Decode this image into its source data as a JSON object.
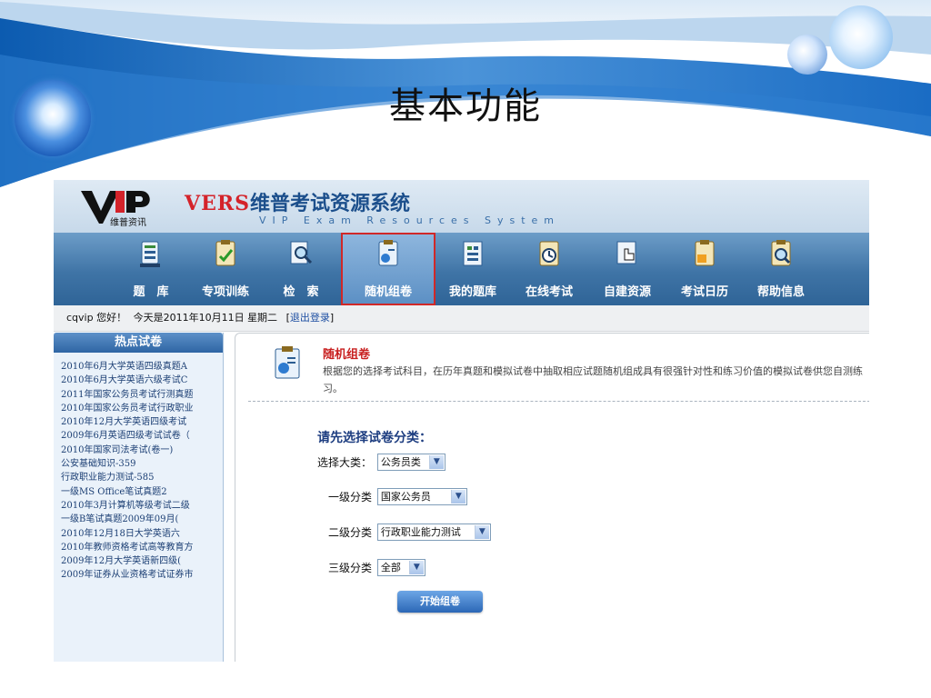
{
  "slide": {
    "title": "基本功能"
  },
  "app": {
    "logo_sub": "维普资讯",
    "title_en": "VERS",
    "title_cn": "维普考试资源系统",
    "subtitle": "VIP Exam Resources System"
  },
  "nav": {
    "items": [
      {
        "label": "题　库",
        "icon": "database-icon"
      },
      {
        "label": "专项训练",
        "icon": "clipboard-check-icon"
      },
      {
        "label": "检　索",
        "icon": "search-document-icon"
      },
      {
        "label": "随机组卷",
        "icon": "random-paper-icon",
        "active": true
      },
      {
        "label": "我的题库",
        "icon": "my-database-icon"
      },
      {
        "label": "在线考试",
        "icon": "clock-icon"
      },
      {
        "label": "自建资源",
        "icon": "hand-pointer-icon"
      },
      {
        "label": "考试日历",
        "icon": "calendar-icon"
      },
      {
        "label": "帮助信息",
        "icon": "help-icon"
      }
    ]
  },
  "status": {
    "user": "cqvip 您好！",
    "date": "今天是2011年10月11日 星期二",
    "logout_open": "[",
    "logout": "退出登录",
    "logout_close": "]"
  },
  "sidebar": {
    "title": "热点试卷",
    "items": [
      "2010年6月大学英语四级真题A",
      "2010年6月大学英语六级考试C",
      "2011年国家公务员考试行测真题",
      "2010年国家公务员考试行政职业",
      "2010年12月大学英语四级考试",
      "2009年6月英语四级考试试卷（",
      "2010年国家司法考试(卷一)",
      "公安基础知识-359",
      "行政职业能力测试-585",
      "一级MS Office笔试真题2",
      "2010年3月计算机等级考试二级",
      "一级B笔试真题2009年09月(",
      "2010年12月18日大学英语六",
      "2010年教师资格考试高等教育方",
      "2009年12月大学英语新四级(",
      "2009年证券从业资格考试证券市"
    ]
  },
  "main": {
    "intro_title": "随机组卷",
    "intro_desc": "根据您的选择考试科目，在历年真题和模拟试卷中抽取相应试题随机组成具有很强针对性和练习价值的模拟试卷供您自测练习。",
    "form_heading": "请先选择试卷分类：",
    "category_label": "选择大类：",
    "category_value": "公务员类",
    "level1_label": "一级分类",
    "level1_value": "国家公务员",
    "level2_label": "二级分类",
    "level2_value": "行政职业能力测试",
    "level3_label": "三级分类",
    "level3_value": "全部",
    "start_button": "开始组卷"
  }
}
